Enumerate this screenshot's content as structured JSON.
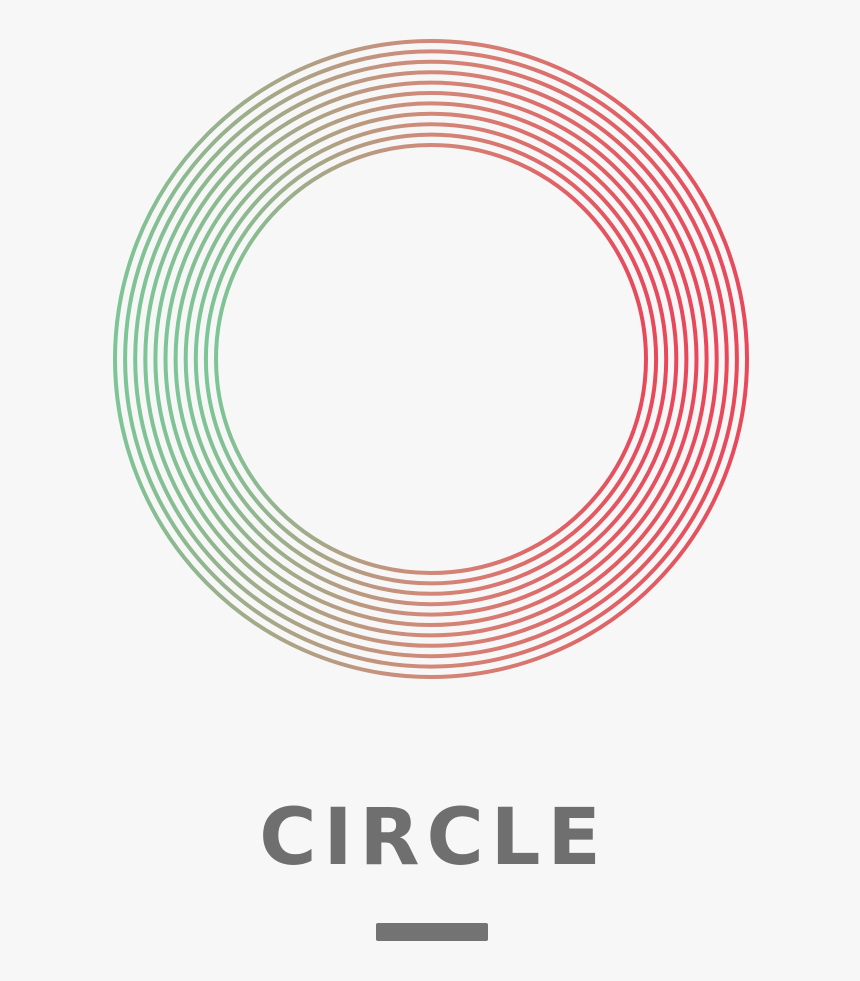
{
  "logo": {
    "title": "CIRCLE",
    "ring_count": 11,
    "gradient_start_color": "#7cc596",
    "gradient_end_color": "#e8485a"
  },
  "colors": {
    "background": "#f7f7f7",
    "text": "#6f6f6f",
    "bar": "#737373"
  }
}
